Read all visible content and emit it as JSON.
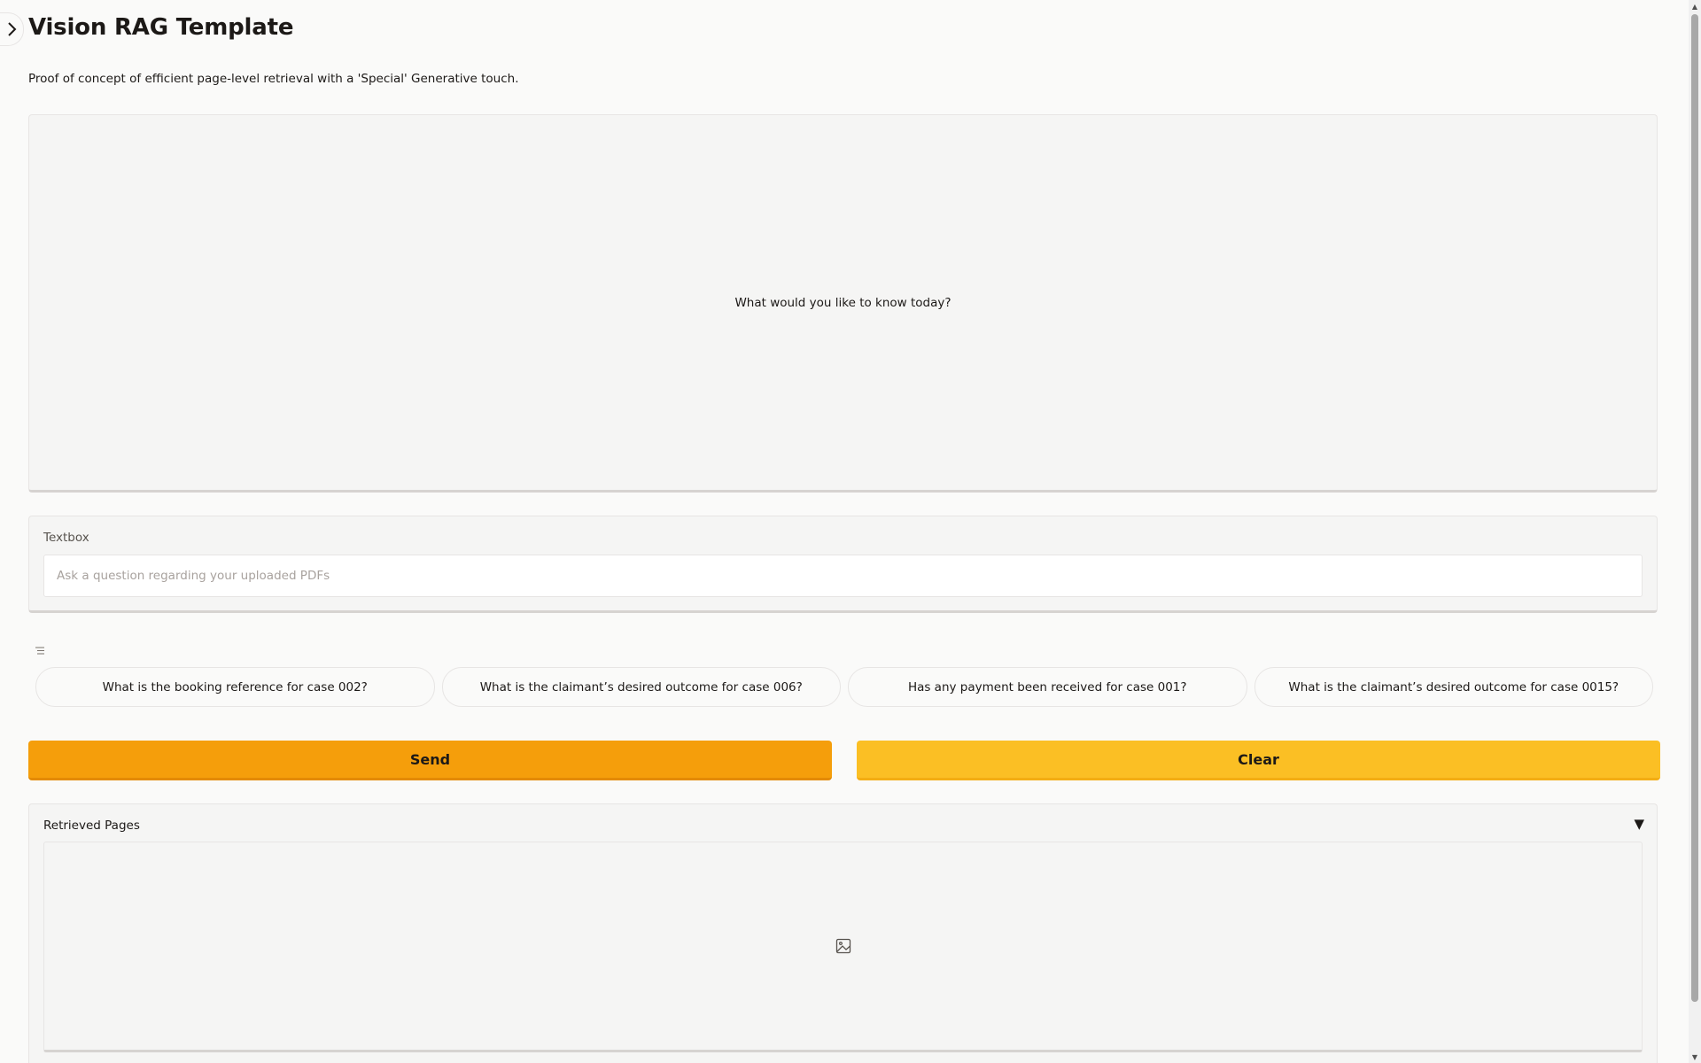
{
  "header": {
    "title": "Vision RAG Template",
    "subtitle": "Proof of concept of efficient page-level retrieval with a 'Special' Generative touch."
  },
  "chatbot": {
    "placeholder": "What would you like to know today?"
  },
  "textbox": {
    "label": "Textbox",
    "placeholder": "Ask a question regarding your uploaded PDFs",
    "value": ""
  },
  "examples": [
    "What is the booking reference for case 002?",
    "What is the claimant’s desired outcome for case 006?",
    "Has any payment been received for case 001?",
    "What is the claimant’s desired outcome for case 0015?"
  ],
  "buttons": {
    "send_label": "Send",
    "clear_label": "Clear"
  },
  "gallery": {
    "label": "Retrieved Pages"
  },
  "icons": {
    "sidebar_toggle": "chevron-right-icon",
    "examples": "list-icon",
    "collapse": "triangle-down-icon",
    "image_placeholder": "image-icon"
  },
  "colors": {
    "send": "#f59e0b",
    "clear": "#fbbf24",
    "background": "#fafaf9",
    "panel": "#f5f5f4"
  }
}
